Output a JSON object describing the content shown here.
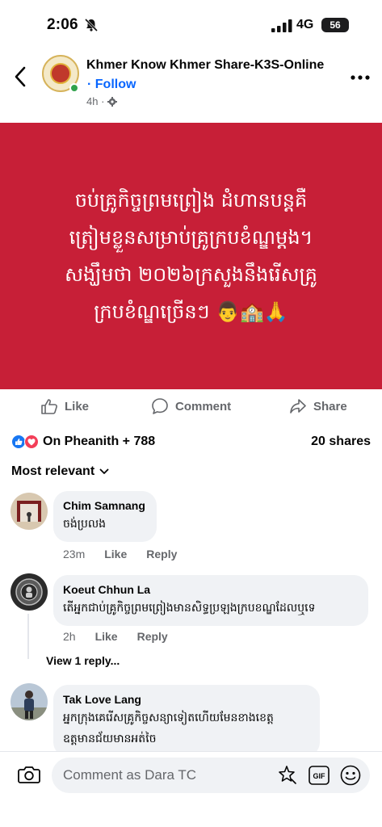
{
  "status_bar": {
    "time": "2:06",
    "network": "4G",
    "battery": "56"
  },
  "post": {
    "page_name": "Khmer Know Khmer Share-K3S-Online",
    "follow": "· Follow",
    "time": "4h ·",
    "background_color": "#c71f37",
    "text_lines": [
      "ចប់គ្រូកិច្ចព្រមព្រៀង ដំហានបន្តគឺ",
      "ត្រៀមខ្លួនសម្រាប់គ្រូក្របខំណ្ឌម្តង។",
      "សង្ឃឹមថា ២០២៦ក្រសួងនឹងរើសគ្រូ",
      "ក្របខំណ្ឌច្រើនៗ 👨‍🏫🙏"
    ]
  },
  "actions": {
    "like": "Like",
    "comment": "Comment",
    "share": "Share"
  },
  "reactions": {
    "summary": "On Pheanith + 788",
    "shares": "20 shares"
  },
  "sort_label": "Most relevant",
  "comments": [
    {
      "name": "Chim Samnang",
      "text": "ចង់ប្រលង",
      "time": "23m",
      "like": "Like",
      "reply": "Reply"
    },
    {
      "name": "Koeut Chhun La",
      "text": "តើអ្នកជាប់គ្រូកិច្ចព្រមព្រៀងមានសិទ្ធប្រឡងក្របខណ្ឌដែលឬទេ",
      "time": "2h",
      "like": "Like",
      "reply": "Reply"
    },
    {
      "name": "Tak Love Lang",
      "text_line1": "អ្នកក្រុងគេរើសគ្រូកិច្ចសន្យាទៀតហើយមែនខាងខេត្ត",
      "text_line2": "ឧត្តមានជ័យមានអត់ចៃ"
    }
  ],
  "view_replies": "View 1 reply...",
  "composer": {
    "placeholder": "Comment as Dara TC"
  },
  "icons": {
    "back": "chevron-left-icon",
    "more": "more-horizontal-icon",
    "like": "thumbs-up-icon",
    "comment": "speech-bubble-icon",
    "share": "share-arrow-icon",
    "camera": "camera-icon",
    "sticker": "sticker-icon",
    "gif": "gif-icon",
    "emoji": "emoji-icon"
  },
  "colors": {
    "link": "#0866ff",
    "like_blue": "#1877f2",
    "love_red": "#f33e58"
  }
}
